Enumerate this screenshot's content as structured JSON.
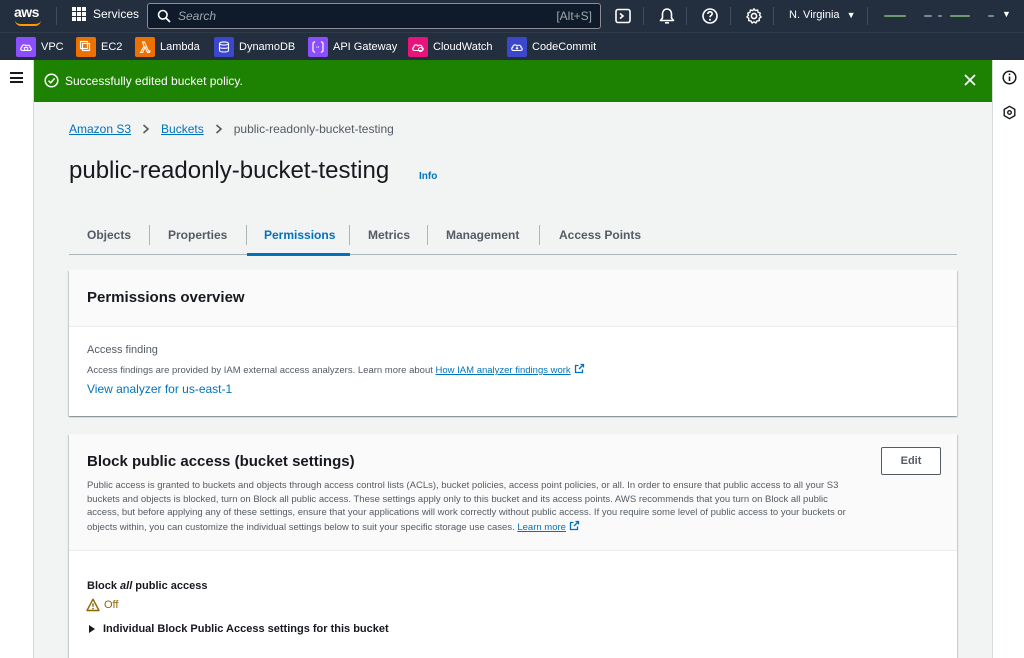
{
  "topnav": {
    "services_label": "Services",
    "search_placeholder": "Search",
    "search_shortcut": "[Alt+S]",
    "region_label": "N. Virginia"
  },
  "favorites": [
    {
      "label": "VPC",
      "color": "#8c4fff"
    },
    {
      "label": "EC2",
      "color": "#ed7100"
    },
    {
      "label": "Lambda",
      "color": "#ed7100"
    },
    {
      "label": "DynamoDB",
      "color": "#3b48cc"
    },
    {
      "label": "API Gateway",
      "color": "#8c4fff"
    },
    {
      "label": "CloudWatch",
      "color": "#e7157b"
    },
    {
      "label": "CodeCommit",
      "color": "#3b48cc"
    }
  ],
  "flash": {
    "message": "Successfully edited bucket policy.",
    "color": "#1d8102"
  },
  "breadcrumb": {
    "items": [
      "Amazon S3",
      "Buckets"
    ],
    "current": "public-readonly-bucket-testing"
  },
  "page": {
    "title": "public-readonly-bucket-testing",
    "info_label": "Info"
  },
  "tabs": [
    {
      "label": "Objects",
      "active": false
    },
    {
      "label": "Properties",
      "active": false
    },
    {
      "label": "Permissions",
      "active": true
    },
    {
      "label": "Metrics",
      "active": false
    },
    {
      "label": "Management",
      "active": false
    },
    {
      "label": "Access Points",
      "active": false
    }
  ],
  "permissions_overview": {
    "title": "Permissions overview",
    "access_finding_label": "Access finding",
    "description": "Access findings are provided by IAM external access analyzers. Learn more about",
    "findings_link": "How IAM analyzer findings work",
    "analyzer_link": "View analyzer for us-east-1"
  },
  "block_public_access": {
    "title": "Block public access (bucket settings)",
    "edit_label": "Edit",
    "description_lines": [
      "Public access is granted to buckets and objects through access control lists (ACLs), bucket policies, access point policies, or all. In order to ensure that public access to all your S3",
      "buckets and objects is blocked, turn on Block all public access. These settings apply only to this bucket and its access points. AWS recommends that you turn on Block all public",
      "access, but before applying any of these settings, ensure that your applications will work correctly without public access. If you require some level of public access to your buckets or",
      "objects within, you can customize the individual settings below to suit your specific storage use cases."
    ],
    "learn_more_link": "Learn more",
    "block_all_prefix": "Block ",
    "block_all_em": "all",
    "block_all_suffix": " public access",
    "status_value": "Off",
    "status_color": "#8d6605",
    "individual_settings_label": "Individual Block Public Access settings for this bucket"
  }
}
